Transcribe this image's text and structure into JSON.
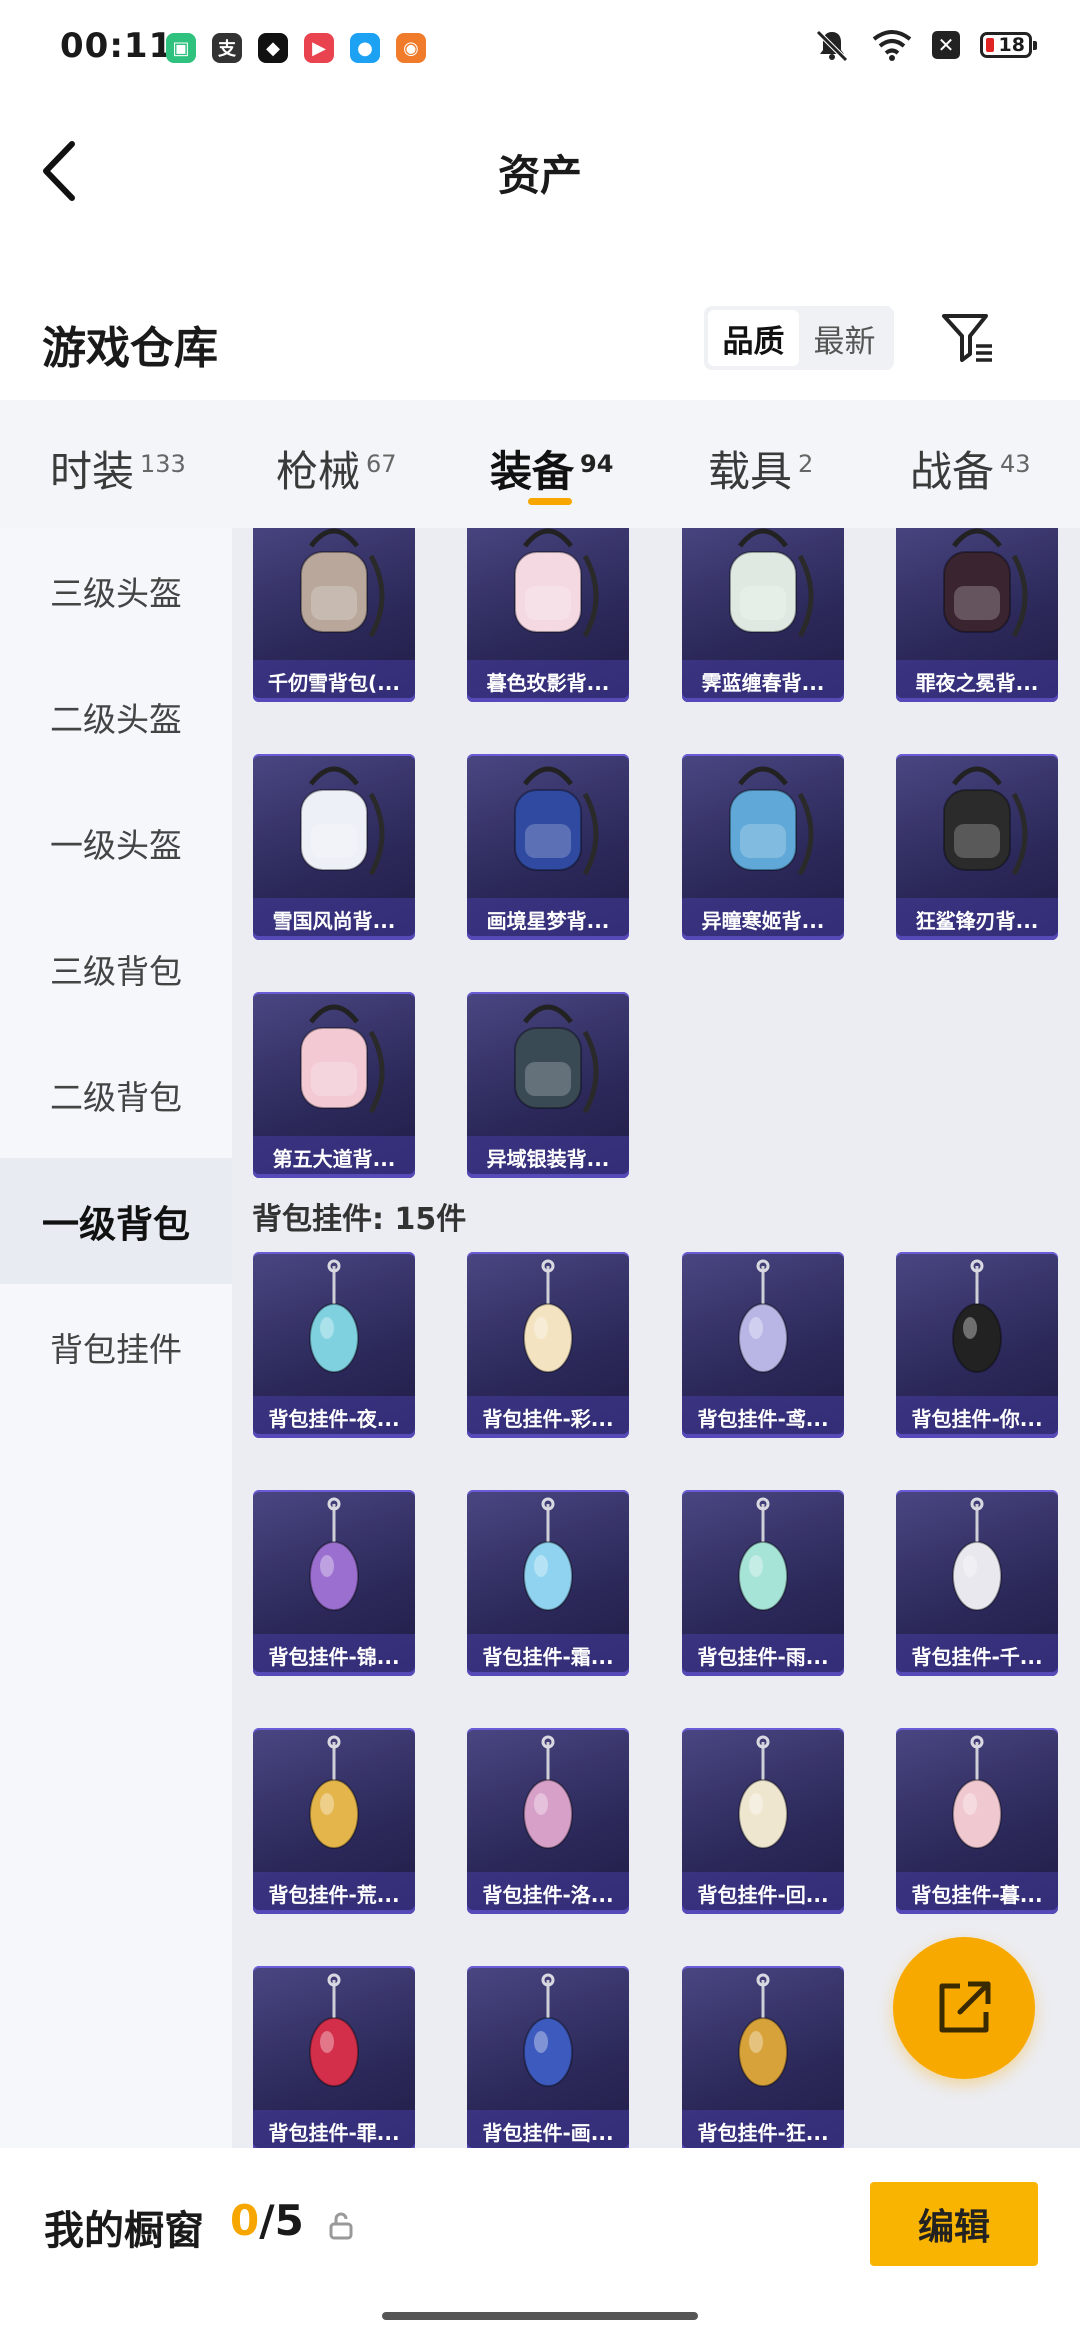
{
  "status_bar": {
    "time": "00:11",
    "battery": "18",
    "apps": [
      {
        "icon": "phone-manager-icon",
        "glyph": "▣",
        "color": "#2ec27e"
      },
      {
        "icon": "zhifubao-icon",
        "glyph": "支",
        "color": "#333333"
      },
      {
        "icon": "shield-app-icon",
        "glyph": "◆",
        "color": "#111111"
      },
      {
        "icon": "video-app-icon",
        "glyph": "▶",
        "color": "#e8434f"
      },
      {
        "icon": "qq-icon",
        "glyph": "●",
        "color": "#1da1f2"
      },
      {
        "icon": "game-app-icon",
        "glyph": "◉",
        "color": "#f07b2a"
      }
    ]
  },
  "header": {
    "title": "资产"
  },
  "section": {
    "title": "游戏仓库"
  },
  "sort": {
    "options": [
      "品质",
      "最新"
    ],
    "active": 0
  },
  "tabs": [
    {
      "label": "时装",
      "count": "133"
    },
    {
      "label": "枪械",
      "count": "67"
    },
    {
      "label": "装备",
      "count": "94"
    },
    {
      "label": "载具",
      "count": "2"
    },
    {
      "label": "战备",
      "count": "43"
    }
  ],
  "active_tab": 2,
  "sidebar": {
    "items": [
      "三级头盔",
      "二级头盔",
      "一级头盔",
      "三级背包",
      "二级背包",
      "一级背包",
      "背包挂件"
    ],
    "active": 5
  },
  "backpacks": [
    {
      "name": "千仞雪背包(...",
      "art": "backpack-icon",
      "tint": "#b8a79a"
    },
    {
      "name": "暮色玫影背...",
      "art": "backpack-icon",
      "tint": "#f4d9e3"
    },
    {
      "name": "霁蓝缠春背...",
      "art": "backpack-icon",
      "tint": "#dfe9e2"
    },
    {
      "name": "罪夜之冕背...",
      "art": "backpack-icon",
      "tint": "#3a2430"
    },
    {
      "name": "雪国风尚背...",
      "art": "backpack-icon",
      "tint": "#eef0f8"
    },
    {
      "name": "画境星梦背...",
      "art": "backpack-icon",
      "tint": "#2f4aa0"
    },
    {
      "name": "异瞳寒姬背...",
      "art": "backpack-icon",
      "tint": "#5fa8d8"
    },
    {
      "name": "狂鲨锋刃背...",
      "art": "backpack-icon",
      "tint": "#2b2b2b"
    },
    {
      "name": "第五大道背...",
      "art": "backpack-icon",
      "tint": "#f3c9d4"
    },
    {
      "name": "异域银装背...",
      "art": "backpack-icon",
      "tint": "#3a4a55"
    }
  ],
  "charm_header": "背包挂件: 15件",
  "charms": [
    {
      "name": "背包挂件-夜...",
      "art": "charm-icon",
      "tint": "#7fd1e0"
    },
    {
      "name": "背包挂件-彩...",
      "art": "charm-icon",
      "tint": "#f3e3c0"
    },
    {
      "name": "背包挂件-鸢...",
      "art": "charm-icon",
      "tint": "#b9b6e6"
    },
    {
      "name": "背包挂件-你...",
      "art": "charm-icon",
      "tint": "#222222"
    },
    {
      "name": "背包挂件-锦...",
      "art": "charm-icon",
      "tint": "#9a6fd0"
    },
    {
      "name": "背包挂件-霜...",
      "art": "charm-icon",
      "tint": "#8fd3f0"
    },
    {
      "name": "背包挂件-雨...",
      "art": "charm-icon",
      "tint": "#a7e4d8"
    },
    {
      "name": "背包挂件-千...",
      "art": "charm-icon",
      "tint": "#e8e8ee"
    },
    {
      "name": "背包挂件-荒...",
      "art": "charm-icon",
      "tint": "#e3b54a"
    },
    {
      "name": "背包挂件-洛...",
      "art": "charm-icon",
      "tint": "#d7a0c8"
    },
    {
      "name": "背包挂件-回...",
      "art": "charm-icon",
      "tint": "#efe6d0"
    },
    {
      "name": "背包挂件-暮...",
      "art": "charm-icon",
      "tint": "#f0c8d0"
    },
    {
      "name": "背包挂件-罪...",
      "art": "charm-icon",
      "tint": "#d32f4a"
    },
    {
      "name": "背包挂件-画...",
      "art": "charm-icon",
      "tint": "#3d5bbf"
    },
    {
      "name": "背包挂件-狂...",
      "art": "charm-icon",
      "tint": "#d8a23a"
    }
  ],
  "showcase": {
    "label": "我的橱窗",
    "current": "0",
    "total": "/5"
  },
  "edit_label": "编辑",
  "colors": {
    "accent": "#f8b400",
    "card_bg": "#2d2a5c",
    "sidebar_active": "#e8ebf2"
  }
}
